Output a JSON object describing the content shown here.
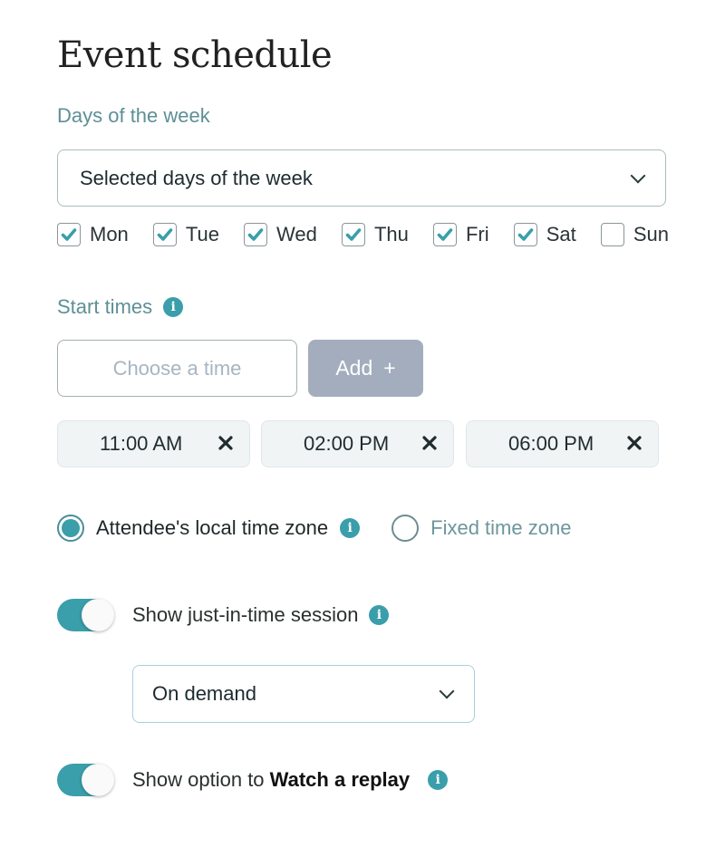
{
  "title": "Event schedule",
  "days_section": {
    "label": "Days of the week",
    "select_value": "Selected days of the week",
    "days": [
      {
        "label": "Mon",
        "checked": true
      },
      {
        "label": "Tue",
        "checked": true
      },
      {
        "label": "Wed",
        "checked": true
      },
      {
        "label": "Thu",
        "checked": true
      },
      {
        "label": "Fri",
        "checked": true
      },
      {
        "label": "Sat",
        "checked": true
      },
      {
        "label": "Sun",
        "checked": false
      }
    ]
  },
  "start_times": {
    "label": "Start times",
    "input_placeholder": "Choose a time",
    "add_label": "Add",
    "add_icon": "+",
    "times": [
      "11:00 AM",
      "02:00 PM",
      "06:00 PM"
    ]
  },
  "timezone": {
    "options": [
      {
        "label": "Attendee's local time zone",
        "selected": true
      },
      {
        "label": "Fixed time zone",
        "selected": false
      }
    ]
  },
  "jit_session": {
    "label": "Show just-in-time session",
    "enabled": true,
    "select_value": "On demand"
  },
  "replay": {
    "label_prefix": "Show option to ",
    "label_bold": "Watch a replay",
    "enabled": true
  },
  "colors": {
    "accent": "#3a9eab",
    "label": "#5e8f96",
    "button_disabled": "#a3adbd"
  }
}
